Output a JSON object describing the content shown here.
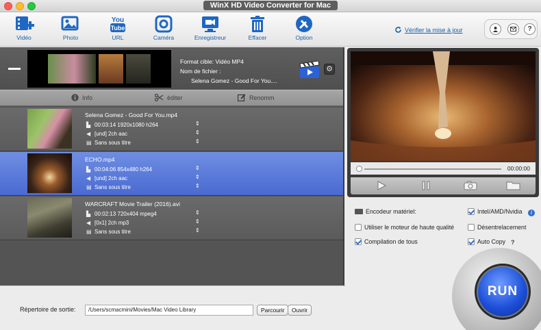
{
  "window": {
    "title": "WinX HD Video Converter for Mac"
  },
  "toolbar": {
    "items": [
      {
        "label": "Vidéo",
        "icon": "add-video-icon"
      },
      {
        "label": "Photo",
        "icon": "photo-icon"
      },
      {
        "label": "URL",
        "icon": "youtube-icon"
      },
      {
        "label": "Caméra",
        "icon": "camera-icon"
      },
      {
        "label": "Enregistreur",
        "icon": "screen-recorder-icon"
      },
      {
        "label": "Effacer",
        "icon": "trash-icon"
      },
      {
        "label": "Option",
        "icon": "tools-icon"
      }
    ],
    "update_label": "Vérifier la mise à jour"
  },
  "header_item": {
    "format_label": "Format cible: Vidéo MP4",
    "filename_label": "Nom de fichier :",
    "filename_value": "Selena Gomez - Good For You....",
    "actions": {
      "info": "Info",
      "edit": "éditer",
      "rename": "Renomm"
    }
  },
  "files": [
    {
      "title": "Selena Gomez - Good For You.mp4",
      "video": "00:03:14 1920x1080 h264",
      "audio": "[und] 2ch aac",
      "subtitle": "Sans sous titre",
      "selected": false
    },
    {
      "title": "ECHO.mp4",
      "video": "00:04:06 854x480 h264",
      "audio": "[und] 2ch aac",
      "subtitle": "Sans sous titre",
      "selected": true
    },
    {
      "title": "WARCRAFT Movie Trailer (2016).avi",
      "video": "00:02:13 720x404 mpeg4",
      "audio": "[0x1] 2ch mp3",
      "subtitle": "Sans sous titre",
      "selected": false
    }
  ],
  "output": {
    "label": "Répertoire de sortie:",
    "path": "/Users/scmacmini/Movies/Mac Video Library",
    "browse": "Parcourir",
    "open": "Ouvrir"
  },
  "player": {
    "time": "00:00:00"
  },
  "options": {
    "hw_encoder": "Encodeur matériel:",
    "intel": {
      "label": "Intel/AMD/Nvidia",
      "checked": true
    },
    "high_quality": {
      "label": "Utiliser le moteur de haute qualité",
      "checked": false
    },
    "deinterlace": {
      "label": "Désentrelacement",
      "checked": false
    },
    "merge": {
      "label": "Compilation de tous",
      "checked": true
    },
    "autocopy": {
      "label": "Auto Copy",
      "checked": true
    },
    "help": "?"
  },
  "run": {
    "label": "RUN"
  },
  "colors": {
    "accent": "#1a5ea8",
    "selected_row": "#5a79da",
    "run_blue": "#1c4fd8"
  }
}
